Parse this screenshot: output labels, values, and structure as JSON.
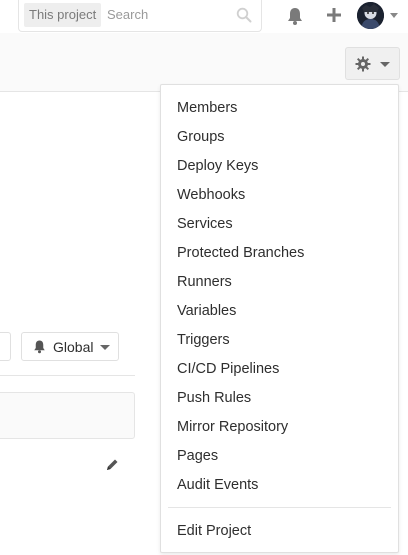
{
  "search": {
    "scope": "This project",
    "placeholder": "Search"
  },
  "header": {
    "icons": [
      "search-icon",
      "bell-icon",
      "plus-icon",
      "chevron-down-icon"
    ]
  },
  "settings_menu": {
    "icon": "gear-icon",
    "items": [
      "Members",
      "Groups",
      "Deploy Keys",
      "Webhooks",
      "Services",
      "Protected Branches",
      "Runners",
      "Variables",
      "Triggers",
      "CI/CD Pipelines",
      "Push Rules",
      "Mirror Repository",
      "Pages",
      "Audit Events"
    ],
    "footer_item": "Edit Project"
  },
  "notification": {
    "label": "Global",
    "icon": "bell-icon"
  },
  "colors": {
    "text": "#2e2e2e",
    "border": "#e5e5e5",
    "muted": "#7a7a7a"
  }
}
